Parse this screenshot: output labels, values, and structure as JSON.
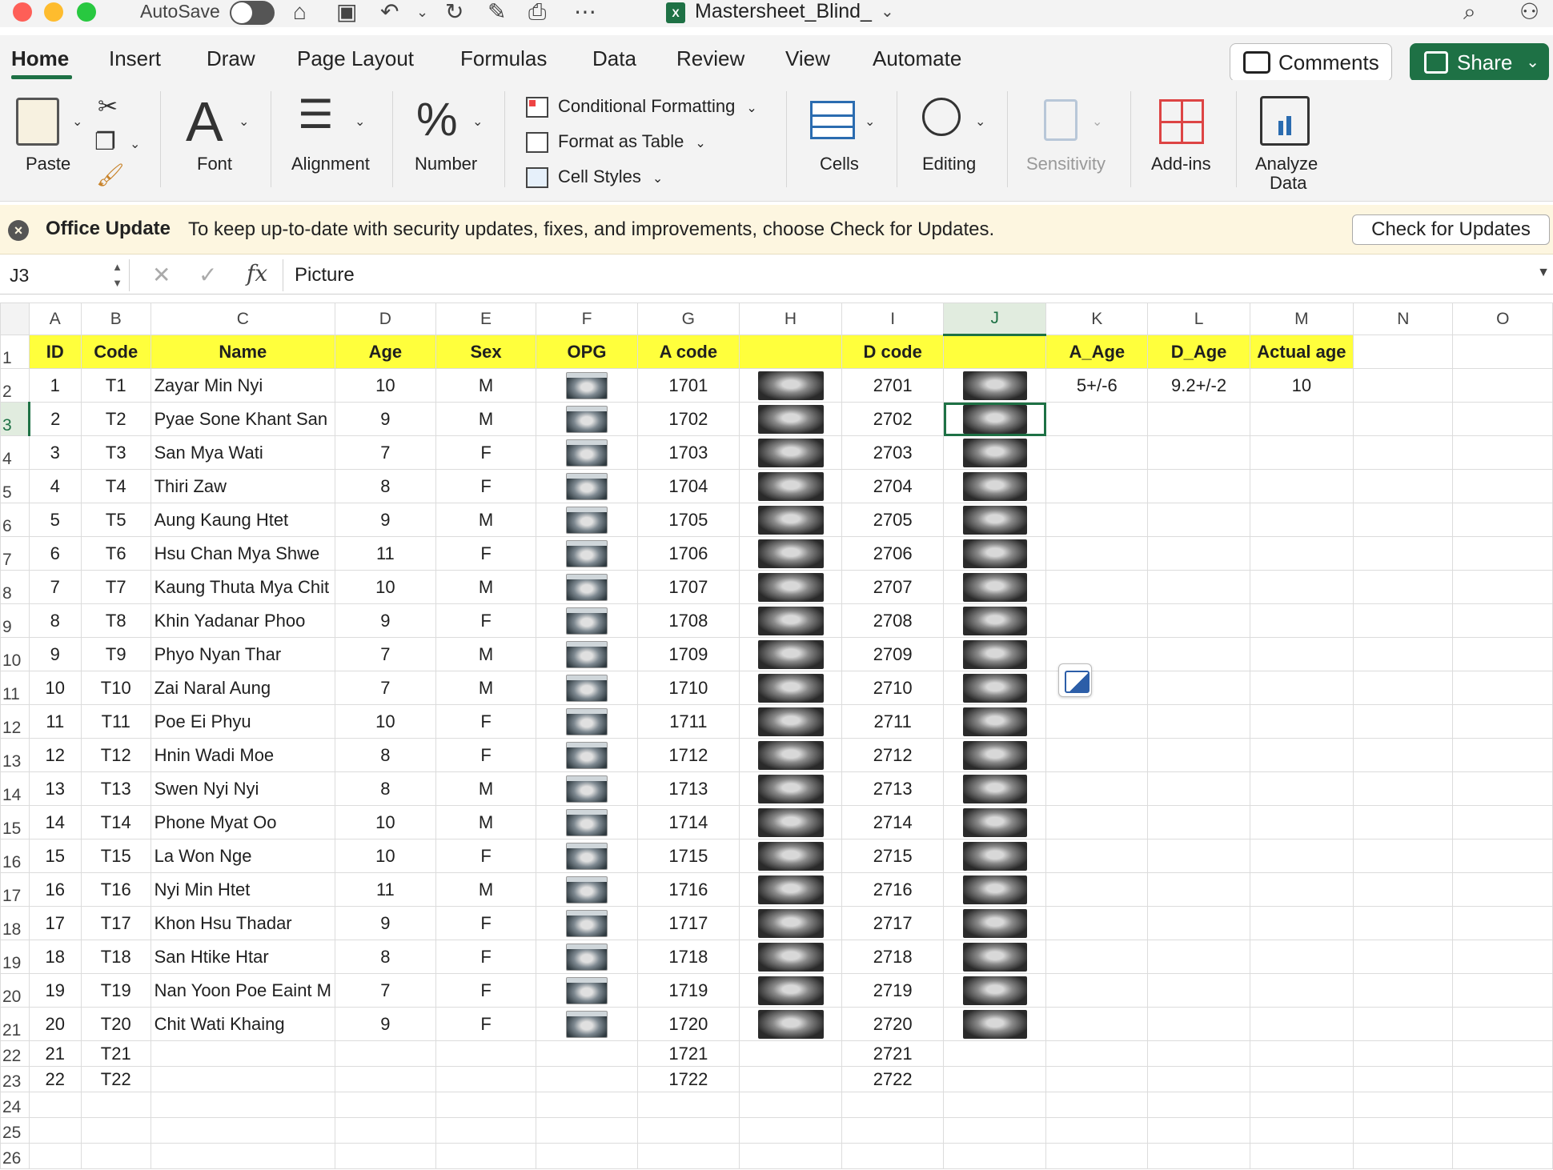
{
  "titlebar": {
    "autosave_label": "AutoSave",
    "doc_title": "Mastersheet_Blind_",
    "xl_badge": "X"
  },
  "tabs": [
    "Home",
    "Insert",
    "Draw",
    "Page Layout",
    "Formulas",
    "Data",
    "Review",
    "View",
    "Automate"
  ],
  "actions": {
    "comments": "Comments",
    "share": "Share"
  },
  "ribbon": {
    "paste": "Paste",
    "font": "Font",
    "alignment": "Alignment",
    "number": "Number",
    "conditional_formatting": "Conditional Formatting",
    "format_as_table": "Format as Table",
    "cell_styles": "Cell Styles",
    "cells": "Cells",
    "editing": "Editing",
    "sensitivity": "Sensitivity",
    "addins": "Add-ins",
    "analyze_line1": "Analyze",
    "analyze_line2": "Data"
  },
  "update_bar": {
    "title": "Office Update",
    "message": "To keep up-to-date with security updates, fixes, and improvements, choose Check for Updates.",
    "button": "Check for Updates"
  },
  "formula_bar": {
    "name_box": "J3",
    "fx": "fx",
    "content": "Picture"
  },
  "columns": [
    "A",
    "B",
    "C",
    "D",
    "E",
    "F",
    "G",
    "H",
    "I",
    "J",
    "K",
    "L",
    "M",
    "N",
    "O"
  ],
  "header_row": {
    "id": "ID",
    "code": "Code",
    "name": "Name",
    "age": "Age",
    "sex": "Sex",
    "opg": "OPG",
    "a_code": "A code",
    "d_code": "D code",
    "a_age": "A_Age",
    "d_age": "D_Age",
    "actual_age": "Actual age"
  },
  "row2_extra": {
    "a_age": "5+/-6",
    "d_age": "9.2+/-2",
    "actual_age": "10"
  },
  "rows": [
    {
      "n": "2",
      "id": "1",
      "code": "T1",
      "name": "Zayar Min Nyi",
      "age": "10",
      "sex": "M",
      "a_code": "1701",
      "d_code": "2701"
    },
    {
      "n": "3",
      "id": "2",
      "code": "T2",
      "name": "Pyae Sone Khant San",
      "age": "9",
      "sex": "M",
      "a_code": "1702",
      "d_code": "2702"
    },
    {
      "n": "4",
      "id": "3",
      "code": "T3",
      "name": "San Mya Wati",
      "age": "7",
      "sex": "F",
      "a_code": "1703",
      "d_code": "2703"
    },
    {
      "n": "5",
      "id": "4",
      "code": "T4",
      "name": "Thiri Zaw",
      "age": "8",
      "sex": "F",
      "a_code": "1704",
      "d_code": "2704"
    },
    {
      "n": "6",
      "id": "5",
      "code": "T5",
      "name": "Aung Kaung Htet",
      "age": "9",
      "sex": "M",
      "a_code": "1705",
      "d_code": "2705"
    },
    {
      "n": "7",
      "id": "6",
      "code": "T6",
      "name": "Hsu Chan Mya Shwe",
      "age": "11",
      "sex": "F",
      "a_code": "1706",
      "d_code": "2706"
    },
    {
      "n": "8",
      "id": "7",
      "code": "T7",
      "name": "Kaung Thuta Mya Chit",
      "age": "10",
      "sex": "M",
      "a_code": "1707",
      "d_code": "2707"
    },
    {
      "n": "9",
      "id": "8",
      "code": "T8",
      "name": "Khin Yadanar Phoo",
      "age": "9",
      "sex": "F",
      "a_code": "1708",
      "d_code": "2708"
    },
    {
      "n": "10",
      "id": "9",
      "code": "T9",
      "name": "Phyo Nyan Thar",
      "age": "7",
      "sex": "M",
      "a_code": "1709",
      "d_code": "2709"
    },
    {
      "n": "11",
      "id": "10",
      "code": "T10",
      "name": "Zai Naral Aung",
      "age": "7",
      "sex": "M",
      "a_code": "1710",
      "d_code": "2710"
    },
    {
      "n": "12",
      "id": "11",
      "code": "T11",
      "name": "Poe Ei Phyu",
      "age": "10",
      "sex": "F",
      "a_code": "1711",
      "d_code": "2711"
    },
    {
      "n": "13",
      "id": "12",
      "code": "T12",
      "name": "Hnin Wadi Moe",
      "age": "8",
      "sex": "F",
      "a_code": "1712",
      "d_code": "2712"
    },
    {
      "n": "14",
      "id": "13",
      "code": "T13",
      "name": "Swen Nyi Nyi",
      "age": "8",
      "sex": "M",
      "a_code": "1713",
      "d_code": "2713"
    },
    {
      "n": "15",
      "id": "14",
      "code": "T14",
      "name": "Phone Myat Oo",
      "age": "10",
      "sex": "M",
      "a_code": "1714",
      "d_code": "2714"
    },
    {
      "n": "16",
      "id": "15",
      "code": "T15",
      "name": "La Won Nge",
      "age": "10",
      "sex": "F",
      "a_code": "1715",
      "d_code": "2715"
    },
    {
      "n": "17",
      "id": "16",
      "code": "T16",
      "name": "Nyi Min Htet",
      "age": "11",
      "sex": "M",
      "a_code": "1716",
      "d_code": "2716"
    },
    {
      "n": "18",
      "id": "17",
      "code": "T17",
      "name": "Khon Hsu Thadar",
      "age": "9",
      "sex": "F",
      "a_code": "1717",
      "d_code": "2717"
    },
    {
      "n": "19",
      "id": "18",
      "code": "T18",
      "name": "San Htike Htar",
      "age": "8",
      "sex": "F",
      "a_code": "1718",
      "d_code": "2718"
    },
    {
      "n": "20",
      "id": "19",
      "code": "T19",
      "name": "Nan Yoon Poe Eaint M",
      "age": "7",
      "sex": "F",
      "a_code": "1719",
      "d_code": "2719"
    },
    {
      "n": "21",
      "id": "20",
      "code": "T20",
      "name": "Chit Wati Khaing",
      "age": "9",
      "sex": "F",
      "a_code": "1720",
      "d_code": "2720"
    }
  ],
  "short_rows": [
    {
      "n": "22",
      "id": "21",
      "code": "T21",
      "a_code": "1721",
      "d_code": "2721"
    },
    {
      "n": "23",
      "id": "22",
      "code": "T22",
      "a_code": "1722",
      "d_code": "2722"
    }
  ],
  "empty_rows": [
    "24",
    "25",
    "26"
  ],
  "colors": {
    "accent": "#1e7145",
    "header_fill": "#ffff3c",
    "update_bar": "#fdf6e0"
  }
}
